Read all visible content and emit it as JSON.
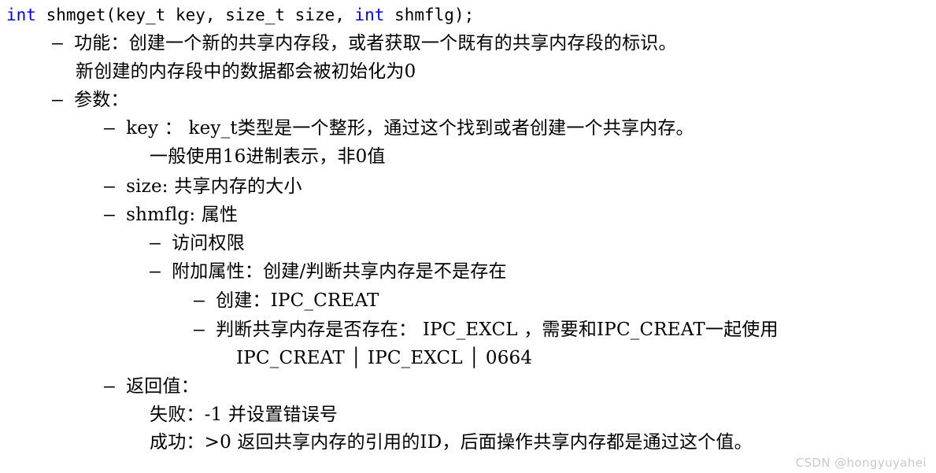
{
  "document": {
    "kind": "code-notes",
    "background_color": "#ffffff",
    "text_color": "#000000",
    "keyword_color": "#0000ff",
    "watermark_color": "#c9c9c9"
  },
  "signature": {
    "kw1": "int",
    "mid": " shmget(key_t key, size_t size, ",
    "kw2": "int",
    "tail": " shmflg);"
  },
  "lines": [
    {
      "id": "l1",
      "indent": 1,
      "bullet": "-",
      "text": "功能：创建一个新的共享内存段，或者获取一个既有的共享内存段的标识。"
    },
    {
      "id": "l2",
      "indent": 1,
      "bullet": "",
      "text": "新创建的内存段中的数据都会被初始化为0"
    },
    {
      "id": "l3",
      "indent": 1,
      "bullet": "-",
      "text": "参数："
    },
    {
      "id": "l4",
      "indent": 2,
      "bullet": "-",
      "text": "key ： key_t类型是一个整形，通过这个找到或者创建一个共享内存。"
    },
    {
      "id": "l5",
      "indent": 2,
      "bullet": "",
      "text": "一般使用16进制表示，非0值"
    },
    {
      "id": "l6",
      "indent": 2,
      "bullet": "-",
      "text": "size: 共享内存的大小"
    },
    {
      "id": "l7",
      "indent": 2,
      "bullet": "-",
      "text": "shmflg: 属性"
    },
    {
      "id": "l8",
      "indent": 3,
      "bullet": "-",
      "text": "访问权限"
    },
    {
      "id": "l9",
      "indent": 3,
      "bullet": "-",
      "text": "附加属性：创建/判断共享内存是不是存在"
    },
    {
      "id": "l10",
      "indent": 4,
      "bullet": "-",
      "text": "创建：IPC_CREAT"
    },
    {
      "id": "l11",
      "indent": 4,
      "bullet": "-",
      "text": "判断共享内存是否存在： IPC_EXCL ，需要和IPC_CREAT一起使用"
    },
    {
      "id": "l12",
      "indent": 4,
      "bullet": "",
      "text": "IPC_CREAT │ IPC_EXCL │ 0664"
    },
    {
      "id": "l13",
      "indent": 2,
      "bullet": "-",
      "text": "返回值："
    },
    {
      "id": "l14",
      "indent": 2,
      "bullet": "",
      "text": "失败：-1 并设置错误号"
    },
    {
      "id": "l15",
      "indent": 2,
      "bullet": "",
      "text": "成功：>0 返回共享内存的引用的ID，后面操作共享内存都是通过这个值。"
    }
  ],
  "watermark": {
    "text": "CSDN @hongyuyahei"
  }
}
